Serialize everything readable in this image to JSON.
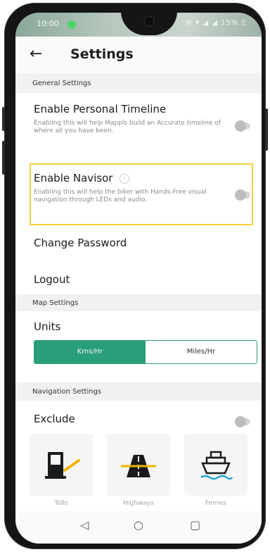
{
  "status_bar": {
    "time": "10:00",
    "icons": "⊕ ▾ ◢ ◢ 15% ▯"
  },
  "header": {
    "title": "Settings",
    "back": "←"
  },
  "sections": {
    "general": "General Settings",
    "map": "Map Settings",
    "navigation": "Navigation Settings"
  },
  "personal_timeline": {
    "title": "Enable Personal Timeline",
    "desc": "Enabling this will help Mappls build an Accurate timeline of where all you have been.",
    "enabled": false
  },
  "navisor": {
    "title": "Enable Navisor",
    "info": "i",
    "desc": "Enabling this will help the biker with Hands-Free visual navigation through LEDs and audio.",
    "enabled": false
  },
  "change_password": "Change Password",
  "logout": "Logout",
  "units": {
    "title": "Units",
    "options": [
      "Kms/Hr",
      "Miles/Hr"
    ],
    "selected": "Kms/Hr"
  },
  "exclude": {
    "title": "Exclude",
    "enabled": false,
    "items": [
      {
        "label": "Tolls",
        "icon": "toll-icon"
      },
      {
        "label": "Highways",
        "icon": "highway-icon"
      },
      {
        "label": "Ferries",
        "icon": "ferry-icon"
      }
    ]
  },
  "nav_bar": {
    "back": "◁",
    "home": "○",
    "recents": "▢"
  },
  "colors": {
    "accent": "#2a9d7a",
    "highlight": "#f2d23c"
  }
}
